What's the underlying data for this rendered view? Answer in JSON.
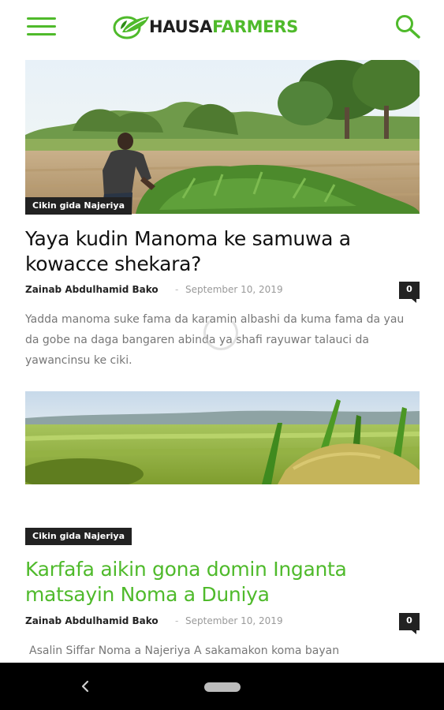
{
  "header": {
    "logo_part1": "HAUSA",
    "logo_part2": "FARMERS",
    "menu_icon": "hamburger-menu-icon",
    "search_icon": "search-icon"
  },
  "colors": {
    "brand_green": "#4fba2b",
    "badge_bg": "#222222",
    "excerpt_text": "#777777"
  },
  "articles": [
    {
      "category": "Cikin gida Najeriya",
      "title": "Yaya kudin Manoma ke samuwa a kowacce shekara?",
      "author": "Zainab Abdulhamid Bako",
      "separator": "-",
      "date": "September 10, 2019",
      "comments": "0",
      "excerpt": "Yadda manoma suke fama da karamin albashi da kuma fama da yau da gobe na daga bangaren abinda ya shafi rayuwar talauci da yawancinsu ke ciki."
    },
    {
      "category": "Cikin gida Najeriya",
      "title": "Karfafa aikin gona domin Inganta matsayin Noma a Duniya",
      "author": "Zainab Abdulhamid Bako",
      "separator": "-",
      "date": "September 10, 2019",
      "comments": "0",
      "excerpt": "Asalin Siffar Noma a Najeriya A sakamakon koma bayan"
    }
  ],
  "system_nav": {
    "back_icon": "back-chevron-icon",
    "home_icon": "home-pill-icon"
  }
}
